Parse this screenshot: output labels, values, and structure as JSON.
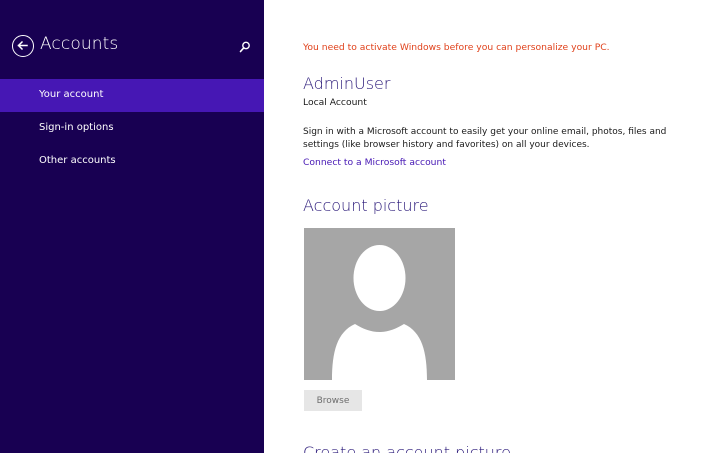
{
  "sidebar": {
    "title": "Accounts",
    "items": [
      {
        "label": "Your account",
        "active": true
      },
      {
        "label": "Sign-in options",
        "active": false
      },
      {
        "label": "Other accounts",
        "active": false
      }
    ]
  },
  "content": {
    "warning": "You need to activate Windows before you can personalize your PC.",
    "user_name": "AdminUser",
    "account_type": "Local Account",
    "description": "Sign in with a Microsoft account to easily get your online email, photos, files and settings (like browser history and favorites) on all your devices.",
    "connect_link": "Connect to a Microsoft account",
    "picture_section_title": "Account picture",
    "browse_label": "Browse",
    "create_section_title": "Create an account picture"
  },
  "colors": {
    "sidebar_bg": "#180052",
    "sidebar_active": "#4617b4",
    "warning": "#e0421c",
    "heading": "#2b1a7a",
    "link": "#4617b4",
    "avatar_bg": "#a6a6a6"
  }
}
